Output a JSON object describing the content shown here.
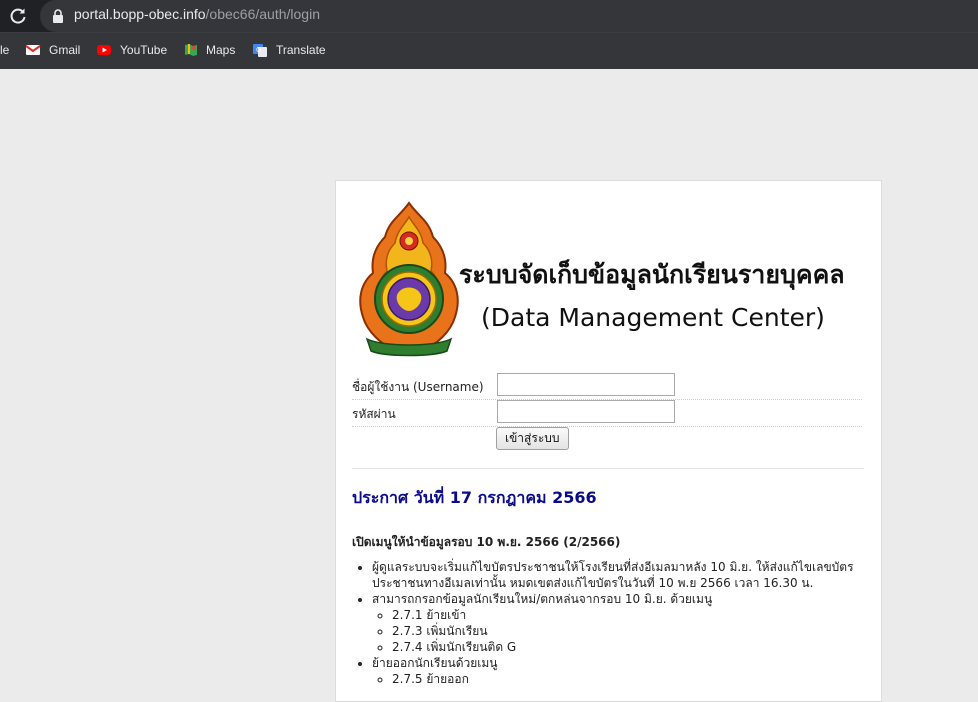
{
  "browser": {
    "url_host": "portal.bopp-obec.info",
    "url_path": "/obec66/auth/login",
    "bookmarks": [
      {
        "label": "le",
        "icon": "folder-icon"
      },
      {
        "label": "Gmail",
        "icon": "gmail-icon"
      },
      {
        "label": "YouTube",
        "icon": "youtube-icon"
      },
      {
        "label": "Maps",
        "icon": "maps-icon"
      },
      {
        "label": "Translate",
        "icon": "translate-icon"
      }
    ]
  },
  "page": {
    "title_th": "ระบบจัดเก็บข้อมูลนักเรียนรายบุคคล",
    "title_en": "(Data Management Center)"
  },
  "login": {
    "username_label": "ชื่อผู้ใช้งาน (Username)",
    "username_value": "",
    "password_label": "รหัสผ่าน",
    "password_value": "",
    "submit_label": "เข้าสู่ระบบ"
  },
  "announcement": {
    "title": "ประกาศ วันที่ 17 กรกฎาคม 2566",
    "subtitle": "เปิดเมนูให้นำข้อมูลรอบ 10 พ.ย. 2566 (2/2566)",
    "items": [
      "ผู้ดูแลระบบจะเริ่มแก้ไขบัตรประชาชนให้โรงเรียนที่ส่งอีเมลมาหลัง 10 มิ.ย. ให้ส่งแก้ไขเลขบัตรประชาชนทางอีเมลเท่านั้น หมดเขตส่งแก้ไขบัตรในวันที่ 10 พ.ย 2566 เวลา 16.30 น.",
      "สามารถกรอกข้อมูลนักเรียนใหม่/ตกหล่นจากรอบ 10 มิ.ย. ด้วยเมนู",
      "ย้ายออกนักเรียนด้วยเมนู"
    ],
    "subitems": [
      "2.7.1 ย้ายเข้า",
      "2.7.3 เพิ่มนักเรียน",
      "2.7.4 เพิ่มนักเรียนติด G"
    ],
    "subitems2": [
      "2.7.5 ย้ายออก"
    ]
  },
  "colors": {
    "chrome_dark": "#202124",
    "chrome_bar": "#35363a",
    "page_bg": "#ebebeb",
    "announcement_title": "#0b0b8a"
  }
}
